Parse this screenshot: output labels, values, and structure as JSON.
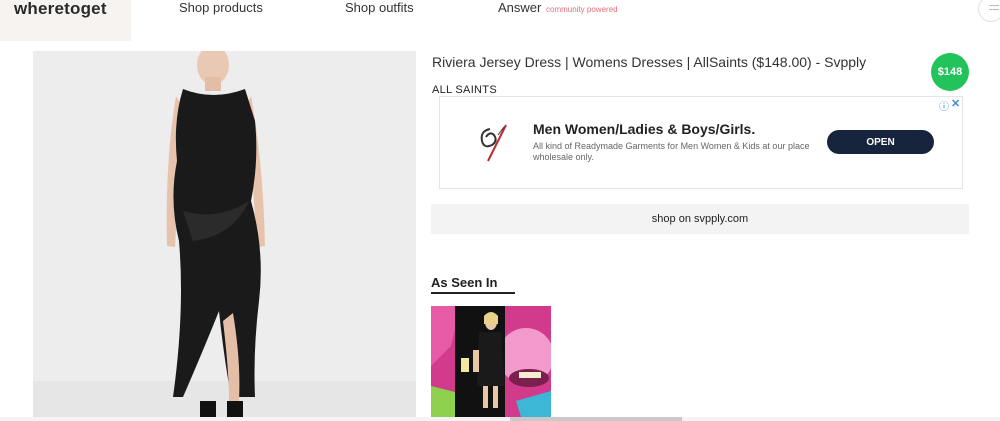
{
  "header": {
    "logo": "wheretoget",
    "nav": {
      "shop_products": "Shop products",
      "shop_outfits": "Shop outfits",
      "answer": "Answer",
      "answer_tag": "community powered"
    }
  },
  "product": {
    "title": "Riviera Jersey Dress | Womens Dresses | AllSaints ($148.00) - Svpply",
    "price": "$148",
    "brand": "ALL SAINTS",
    "shop_button": "shop on svpply.com"
  },
  "ad": {
    "headline": "Men Women/Ladies & Boys/Girls.",
    "body": "All kind of Readymade Garments for Men Women & Kids at our place wholesale only.",
    "cta": "OPEN",
    "info_icon": "info-icon",
    "close_icon": "close-icon"
  },
  "as_seen_in": {
    "heading": "As Seen In"
  },
  "colors": {
    "price_badge": "#21c35a",
    "ad_button": "#16253d",
    "answer_tag": "#e0707a"
  }
}
